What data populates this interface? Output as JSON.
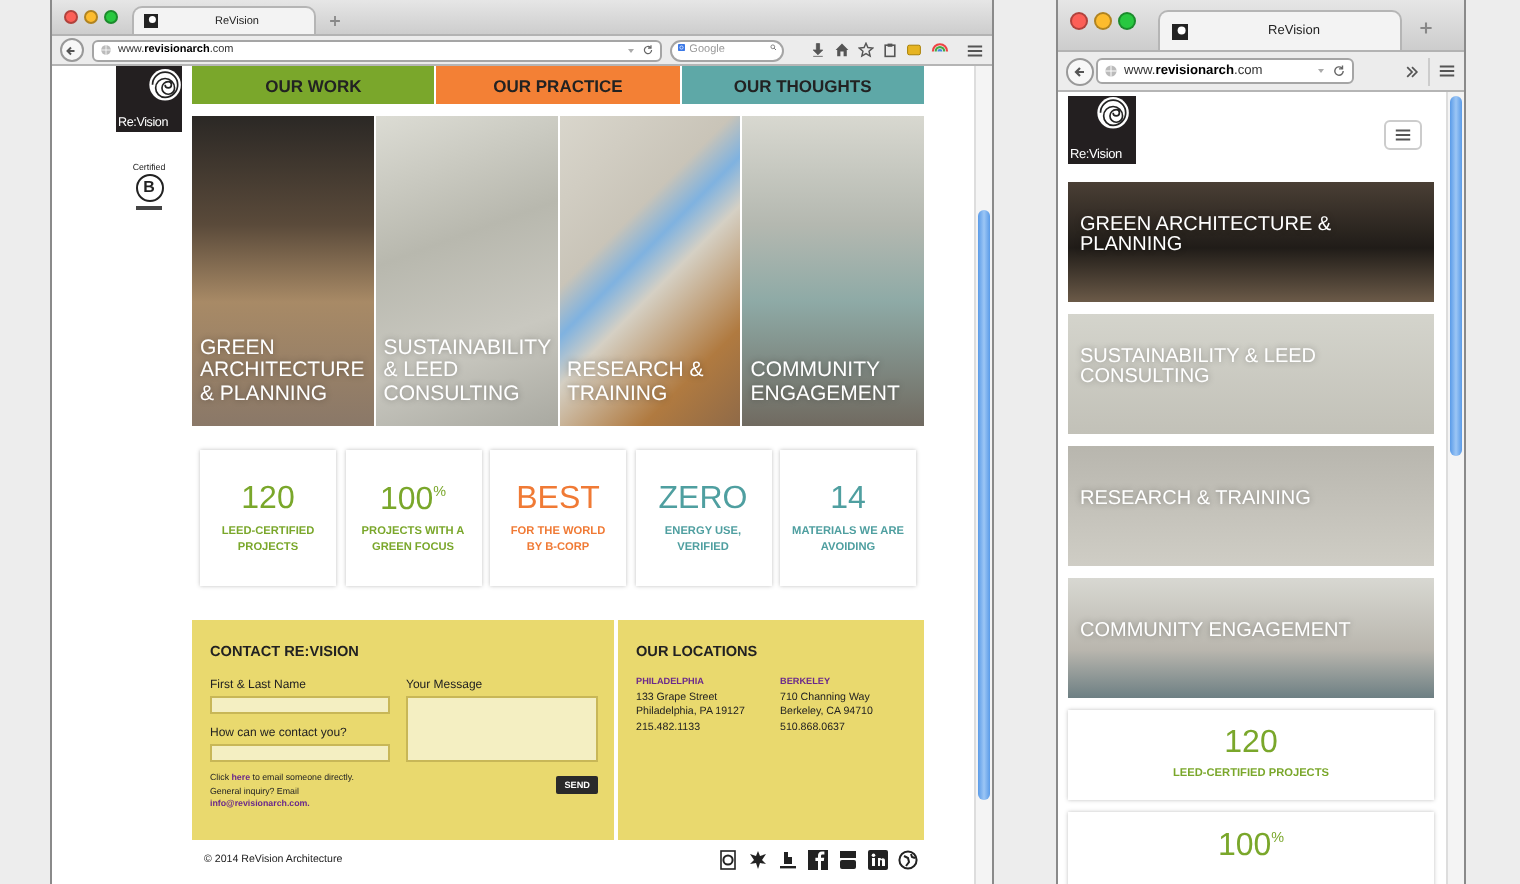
{
  "windows": [
    {
      "kind": "desktop",
      "tab_title": "ReVision",
      "url": "www.**revisionarch**.com",
      "search": {
        "placeholder": "Google"
      },
      "logo_text": "Re:Vision",
      "badge": {
        "label": "Certified",
        "mark": "B"
      },
      "nav": [
        {
          "label": "OUR WORK",
          "color": "#7aa72b"
        },
        {
          "label": "OUR PRACTICE",
          "color": "#f38035"
        },
        {
          "label": "OUR THOUGHTS",
          "color": "#5ea8a7"
        }
      ],
      "tiles": [
        {
          "label": "GREEN ARCHITECTURE & PLANNING"
        },
        {
          "label": "SUSTAINABILITY & LEED CONSULTING"
        },
        {
          "label": "RESEARCH & TRAINING"
        },
        {
          "label": "COMMUNITY ENGAGEMENT"
        }
      ],
      "stats": [
        {
          "value": "120",
          "label": "LEED-CERTIFIED PROJECTS",
          "color": "#7aa72b"
        },
        {
          "value": "100$^{%}$",
          "label": "PROJECTS WITH A GREEN FOCUS",
          "color": "#7aa72b"
        },
        {
          "value": "BEST",
          "label": "FOR THE WORLD BY B-CORP",
          "color": "#f07a35"
        },
        {
          "value": "ZERO",
          "label": "ENERGY USE, VERIFIED",
          "color": "#4f9fa0"
        },
        {
          "value": "14",
          "label": "MATERIALS WE ARE AVOIDING",
          "color": "#4f9fa0"
        }
      ],
      "contact": {
        "title": "CONTACT RE:VISION",
        "fields": [
          {
            "label": "First & Last Name"
          },
          {
            "label": "How can we contact you?"
          }
        ],
        "message_label": "Your Message",
        "note": {
          "before": "Click",
          "link": "here",
          "after": "to email someone directly."
        },
        "inquiry": {
          "text": "General inquiry? Email",
          "link": "info@revisionarch.com."
        },
        "send": "SEND"
      },
      "locations": {
        "title": "OUR LOCATIONS",
        "offices": [
          {
            "city": "PHILADELPHIA",
            "lines": [
              "133 Grape Street",
              "Philadelphia, PA 19127",
              "215.482.1133"
            ]
          },
          {
            "city": "BERKELEY",
            "lines": [
              "710 Channing Way",
              "Berkeley, CA 94710",
              "510.868.0637"
            ]
          }
        ]
      },
      "footer": {
        "copyright": "© 2014 ReVision Architecture"
      }
    },
    {
      "kind": "mobile",
      "tab_title": "ReVision",
      "url": "www.**revisionarch**.com",
      "logo_text": "Re:Vision",
      "tiles": [
        {
          "label": "GREEN ARCHITECTURE & PLANNING"
        },
        {
          "label": "SUSTAINABILITY & LEED CONSULTING"
        },
        {
          "label": "RESEARCH & TRAINING"
        },
        {
          "label": "COMMUNITY ENGAGEMENT"
        }
      ],
      "stats": [
        {
          "value": "120",
          "label": "LEED-CERTIFIED PROJECTS",
          "color": "#7aa72b"
        },
        {
          "value": "100$^{%}$",
          "color": "#7aa72b"
        }
      ]
    }
  ]
}
